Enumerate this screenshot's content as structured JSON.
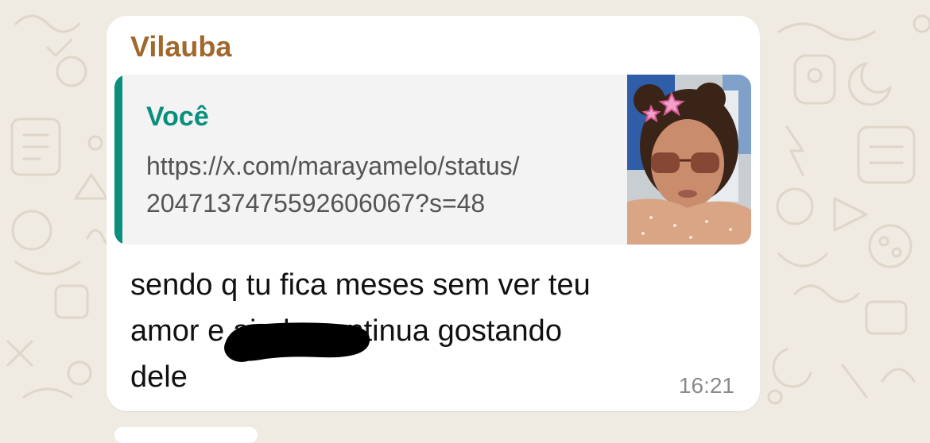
{
  "colors": {
    "wallpaper": "#EFEAE2",
    "bubble": "#FFFFFF",
    "sender": "#A0682D",
    "quote_accent": "#0A8F7D",
    "quote_background": "#F4F3F4",
    "message_text": "#111111",
    "timestamp": "#8A8A8A"
  },
  "message": {
    "sender": "Vilauba",
    "quoted": {
      "author": "Você",
      "text_lines": [
        "https://x.com/marayamelo/status/",
        "2047137475592606067?s=48"
      ],
      "thumbnail": "photo-thumbnail"
    },
    "text_lines": [
      "sendo q tu fica meses sem ver teu",
      "amor e ainda continua gostando",
      "dele"
    ],
    "time": "16:21"
  }
}
